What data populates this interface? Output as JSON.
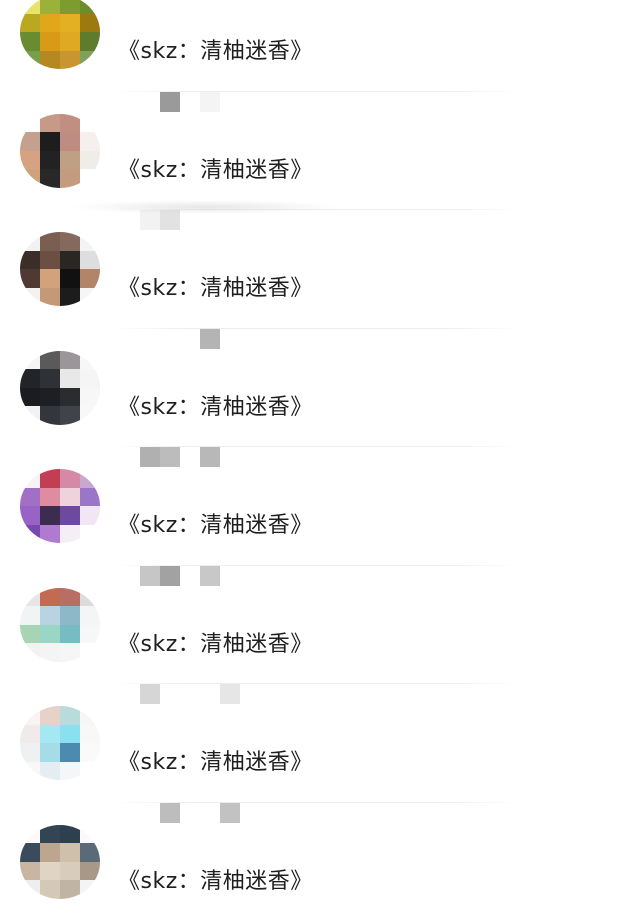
{
  "conversation_list": {
    "items": [
      {
        "message": "《skz：清柚迷香》",
        "avatar_icon": "sunflower-avatar-icon",
        "avatar_colors": [
          "#e8e46a",
          "#9bb23a",
          "#7d9c2e",
          "#6f8b2a",
          "#b9a820",
          "#e0a71a",
          "#e3b024",
          "#9c7a10",
          "#6a8b30",
          "#d89b18",
          "#e0a924",
          "#5f7c2c",
          "#78a048",
          "#b58822",
          "#c99530",
          "#7ea15a"
        ],
        "name_mosaic_colors": [
          "#a6a6a6"
        ]
      },
      {
        "message": "《skz：清柚迷香》",
        "avatar_icon": "person-photo-avatar-icon",
        "avatar_colors": [
          "#ffffff",
          "#c79a88",
          "#c08f82",
          "#ffffff",
          "#c4a08e",
          "#1d1d1d",
          "#bf8c84",
          "#f5f0ee",
          "#d6a282",
          "#222222",
          "#bfa084",
          "#f0ece8",
          "#cfa27e",
          "#282828",
          "#c59b80",
          "#ffffff"
        ],
        "name_mosaic_colors": [
          "#9a9a9a",
          "#f4f4f4"
        ]
      },
      {
        "message": "《skz：清柚迷香》",
        "avatar_icon": "dark-hair-avatar-icon",
        "avatar_colors": [
          "#f2f2f2",
          "#7a5e52",
          "#85695c",
          "#f4f4f4",
          "#3b2d28",
          "#6c4f42",
          "#2a2623",
          "#dedede",
          "#4e3a30",
          "#d2a27c",
          "#111111",
          "#b28468",
          "#f2f2f2",
          "#c59976",
          "#1c1c1c",
          "#f6f6f6"
        ],
        "name_mosaic_colors": [
          "#f2f2f2",
          "#e2e2e2"
        ]
      },
      {
        "message": "《skz：清柚迷香》",
        "avatar_icon": "black-outfit-avatar-icon",
        "avatar_colors": [
          "#f5f5f5",
          "#5a5a5a",
          "#9a9699",
          "#f7f7f7",
          "#222428",
          "#2e3136",
          "#e8e8e8",
          "#f5f5f5",
          "#1a1c20",
          "#1d1f22",
          "#2a2c30",
          "#f7f7f7",
          "#f2f2f2",
          "#33363a",
          "#40434a",
          "#f8f8f8"
        ],
        "name_mosaic_colors": [
          "#b4b4b4"
        ]
      },
      {
        "message": "《skz：清柚迷香》",
        "avatar_icon": "purple-art-avatar-icon",
        "avatar_colors": [
          "#f7f2f6",
          "#c23e52",
          "#d48aa6",
          "#c8a8d0",
          "#a16fc4",
          "#de8ca0",
          "#f0d2dc",
          "#9a76c8",
          "#9863c4",
          "#3c2c50",
          "#6c4aa0",
          "#f0e6f4",
          "#7848b0",
          "#b07ad0",
          "#f4eef6",
          "#ffffff"
        ],
        "name_mosaic_colors": [
          "#b0b0b0",
          "#bcbcbc",
          "#b8b8b8"
        ]
      },
      {
        "message": "《skz：清柚迷香》",
        "avatar_icon": "pastel-scene-avatar-icon",
        "avatar_colors": [
          "#e6e6e6",
          "#c26b52",
          "#b86e64",
          "#dcdcdc",
          "#f0f4f4",
          "#b8d4e2",
          "#8cb8c8",
          "#f4f6f6",
          "#a6d4b4",
          "#9ad6c6",
          "#76bcc2",
          "#f6f8f8",
          "#f2f2f2",
          "#f4f4f4",
          "#f6f6f6",
          "#ffffff"
        ],
        "name_mosaic_colors": [
          "#c6c6c6",
          "#a2a2a2",
          "#c8c8c8"
        ]
      },
      {
        "message": "《skz：清柚迷香》",
        "avatar_icon": "light-blue-avatar-icon",
        "avatar_colors": [
          "#f7f4f2",
          "#e6d2c8",
          "#b8dcdc",
          "#f6f6f6",
          "#f0eaea",
          "#a6e8f2",
          "#8ae0ee",
          "#f8f8f8",
          "#eef0f2",
          "#a6dce8",
          "#4c8ab0",
          "#fafafa",
          "#f8f8f8",
          "#e4eef2",
          "#f4f6f8",
          "#ffffff"
        ],
        "name_mosaic_colors": [
          "#d6d6d6",
          "#e6e6e6"
        ]
      },
      {
        "message": "《skz：清柚迷香》",
        "avatar_icon": "portrait-avatar-icon",
        "avatar_colors": [
          "#fafafa",
          "#334455",
          "#2e4050",
          "#fafafa",
          "#3a4c5c",
          "#bca690",
          "#cfc0ac",
          "#5a6a78",
          "#c8b6a2",
          "#e0d4c4",
          "#d8ccbc",
          "#a89888",
          "#eeeeee",
          "#d4c8b8",
          "#c0b4a4",
          "#f4f4f4"
        ],
        "name_mosaic_colors": [
          "#bdbdbd",
          "#c2c2c2"
        ]
      }
    ]
  }
}
